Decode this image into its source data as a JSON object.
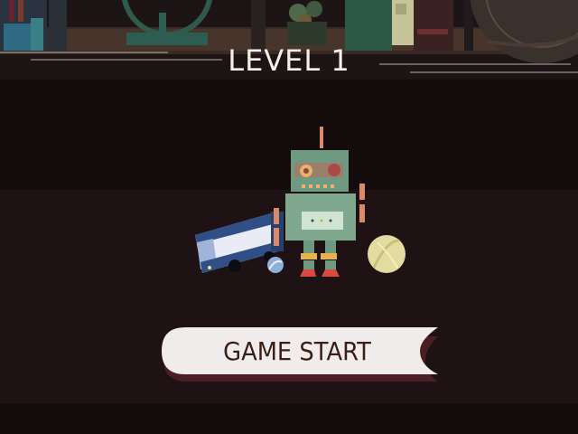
{
  "screen": {
    "level_title": "LEVEL 1",
    "start_button_label": "GAME START"
  },
  "colors": {
    "background": "#1e1214",
    "title_text": "#f4f1ea",
    "button_fill": "#f0ecec",
    "button_text": "#3a1e14",
    "robot_body": "#7fa88f",
    "bus_body": "#2f4f86"
  },
  "toys": [
    "robot",
    "toy-bus",
    "blue-marble",
    "yellow-ball"
  ]
}
